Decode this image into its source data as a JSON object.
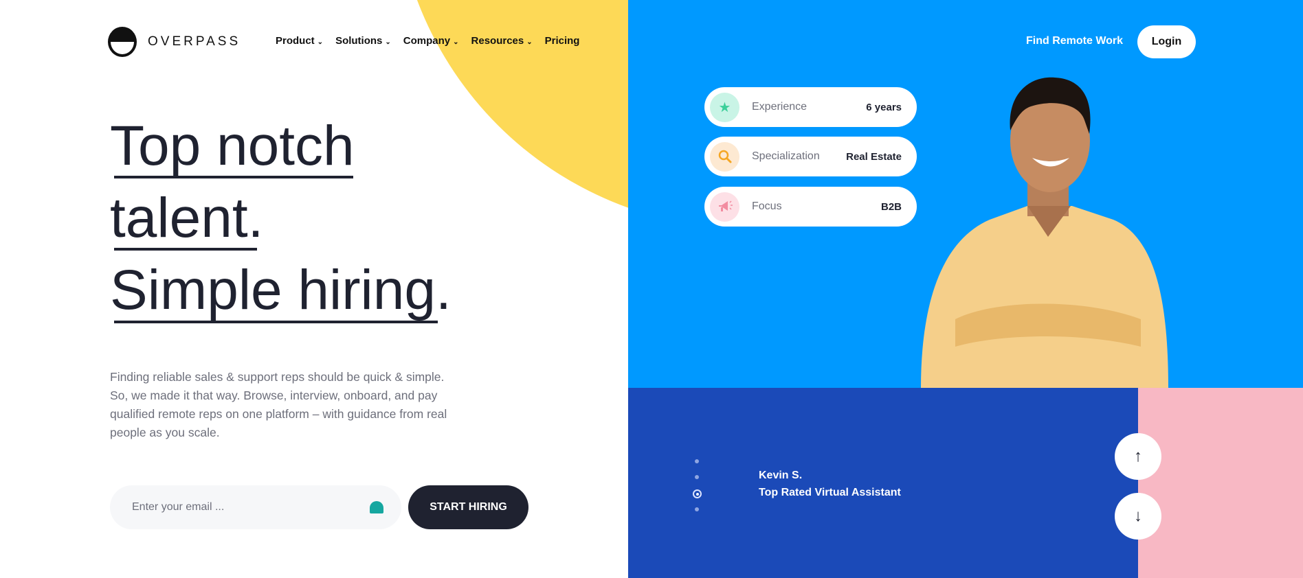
{
  "brand": {
    "name": "OVERPASS"
  },
  "nav": {
    "items": [
      {
        "label": "Product",
        "dropdown": true
      },
      {
        "label": "Solutions",
        "dropdown": true
      },
      {
        "label": "Company",
        "dropdown": true
      },
      {
        "label": "Resources",
        "dropdown": true
      },
      {
        "label": "Pricing",
        "dropdown": false
      }
    ],
    "find_work": "Find Remote Work",
    "login": "Login"
  },
  "hero": {
    "lines": [
      "Top notch",
      "talent.",
      "Simple hiring."
    ],
    "description": "Finding reliable sales & support reps should be quick & simple. So, we made it that way. Browse, interview, onboard, and pay qualified remote reps on one platform – with guidance from real people as you scale.",
    "email_placeholder": "Enter your email ...",
    "cta": "START HIRING"
  },
  "profile_stats": [
    {
      "icon": "star-icon",
      "label": "Experience",
      "value": "6 years",
      "color": "#3ccf9a"
    },
    {
      "icon": "search-icon",
      "label": "Specialization",
      "value": "Real Estate",
      "color": "#f5a623"
    },
    {
      "icon": "megaphone-icon",
      "label": "Focus",
      "value": "B2B",
      "color": "#f28ca0"
    }
  ],
  "testimonial": {
    "name": "Kevin S.",
    "title": "Top Rated Virtual Assistant",
    "active_index": 2,
    "count": 4
  },
  "colors": {
    "yellow": "#fdd957",
    "blue": "#0099ff",
    "navy": "#1b4ab8",
    "pink": "#f8b8c4",
    "dark": "#1f2230"
  }
}
